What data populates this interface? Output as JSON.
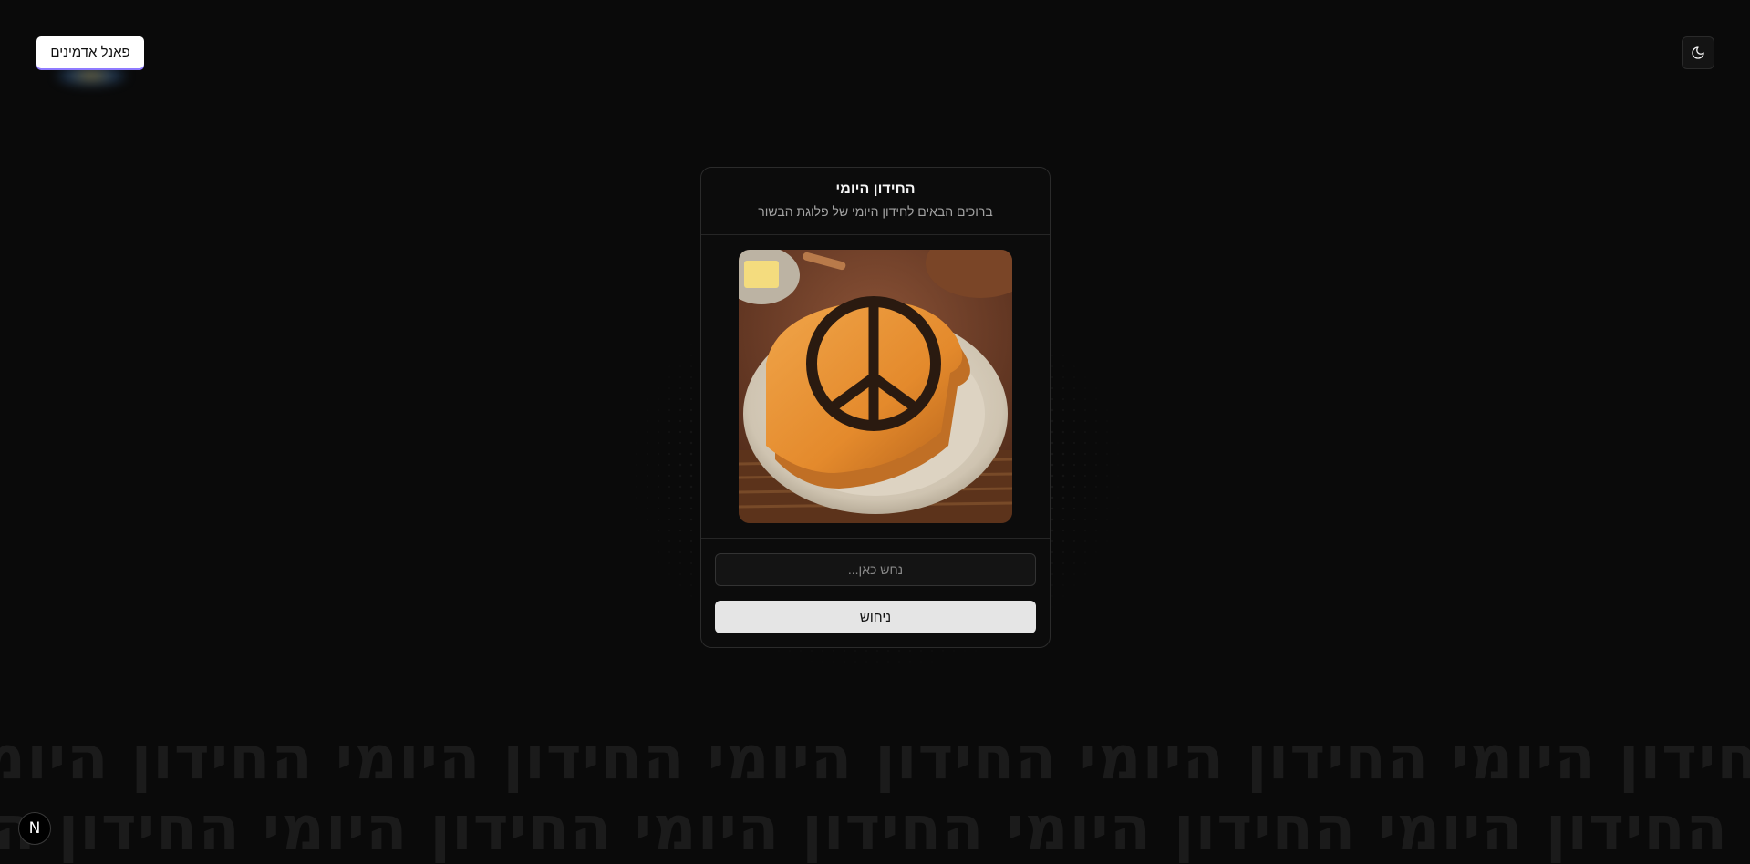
{
  "header": {
    "admin_button_label": "פאנל אדמינים",
    "theme_toggle_icon": "moon-icon"
  },
  "card": {
    "title": "החידון היומי",
    "subtitle": "ברוכים הבאים לחידון היומי של פלוגת הבשור",
    "image": {
      "subject": "toast-peace-sign-image"
    },
    "input_placeholder": "נחש כאן...",
    "input_value": "",
    "submit_label": "ניחוש"
  },
  "background": {
    "marquee_line_1": "החידון היומי החידון היומי החידון היומי החידון היומי החידון היומי",
    "marquee_line_2": "החידון היומי החידון היומי החידון היומי החידון היומי החידון היומי"
  },
  "badge": {
    "label": "N"
  },
  "colors": {
    "background": "#0a0a0a",
    "card_border": "#2b2b2b",
    "button_bg": "#e5e5e5",
    "admin_accent": "#8f7bff"
  }
}
